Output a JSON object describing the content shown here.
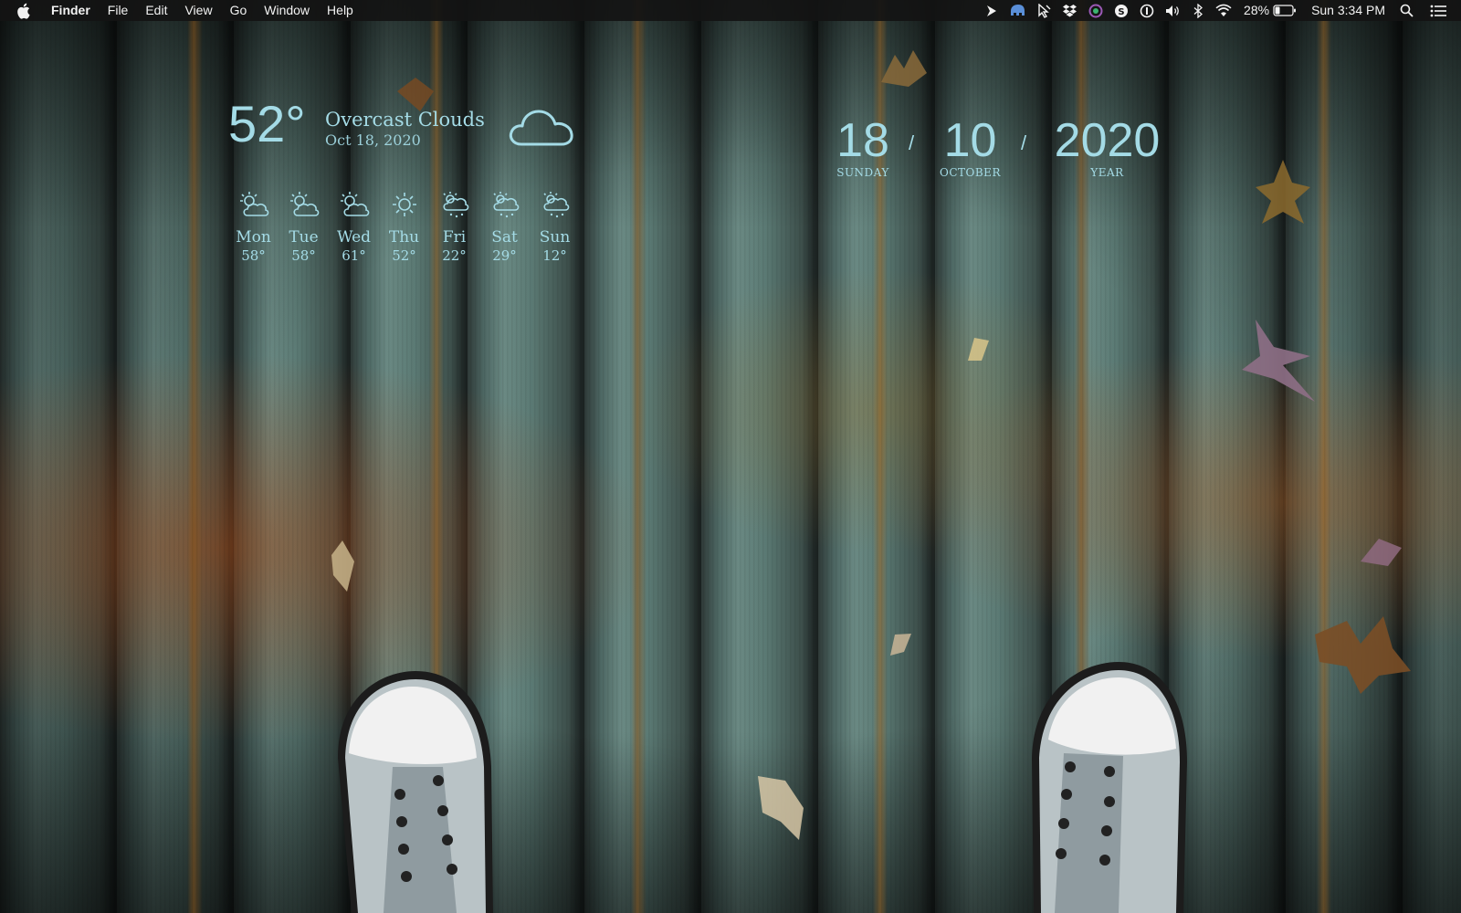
{
  "menubar": {
    "app_name": "Finder",
    "menus": [
      "File",
      "Edit",
      "View",
      "Go",
      "Window",
      "Help"
    ],
    "status_icons": [
      "prompt-icon",
      "elephant-icon",
      "mouse-pointer-icon",
      "dropbox-icon",
      "color-picker-icon",
      "skype-icon",
      "one-password-icon",
      "volume-icon",
      "bluetooth-icon",
      "wifi-icon"
    ],
    "battery_percent": "28%",
    "clock": "Sun 3:34 PM"
  },
  "weather": {
    "temperature": "52°",
    "condition": "Overcast Clouds",
    "date": "Oct 18, 2020",
    "icon": "cloud-icon",
    "forecast": [
      {
        "day": "Mon",
        "temp": "58°",
        "icon": "partly-cloudy-icon"
      },
      {
        "day": "Tue",
        "temp": "58°",
        "icon": "partly-cloudy-icon"
      },
      {
        "day": "Wed",
        "temp": "61°",
        "icon": "partly-cloudy-icon"
      },
      {
        "day": "Thu",
        "temp": "52°",
        "icon": "sun-icon"
      },
      {
        "day": "Fri",
        "temp": "22°",
        "icon": "snow-cloud-icon"
      },
      {
        "day": "Sat",
        "temp": "29°",
        "icon": "snow-cloud-icon"
      },
      {
        "day": "Sun",
        "temp": "12°",
        "icon": "snow-cloud-icon"
      }
    ]
  },
  "date_widget": {
    "day": "18",
    "day_label": "SUNDAY",
    "month": "10",
    "month_label": "OCTOBER",
    "year": "2020",
    "year_label": "YEAR",
    "separator": "/"
  },
  "colors": {
    "widget_text": "#a4dbe6",
    "menubar_bg": "#141414"
  }
}
